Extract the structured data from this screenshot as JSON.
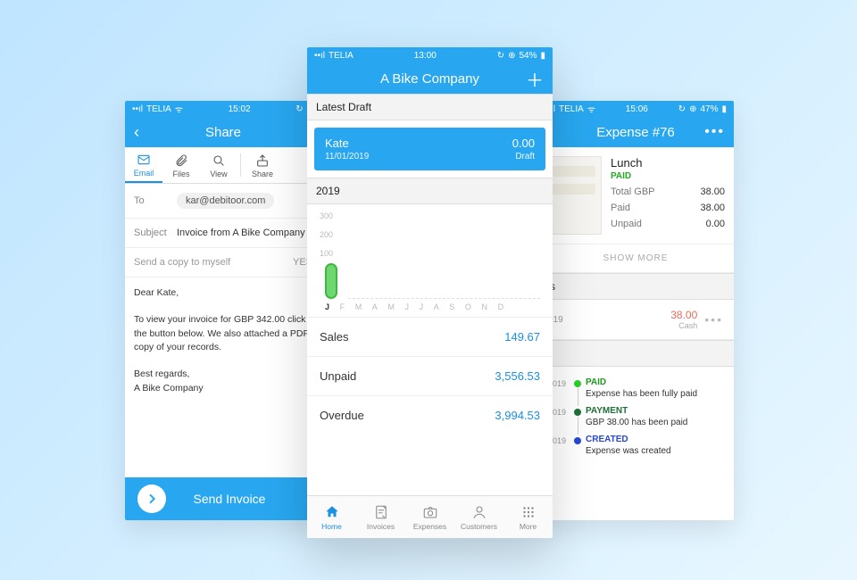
{
  "left": {
    "status": {
      "carrier": "TELIA",
      "time": "15:02"
    },
    "title": "Share",
    "tools": {
      "email": "Email",
      "files": "Files",
      "view": "View",
      "share": "Share"
    },
    "to_label": "To",
    "to_value": "kar@debitoor.com",
    "subject_label": "Subject",
    "subject_value": "Invoice from A Bike Company",
    "copy_label": "Send a copy to myself",
    "copy_value": "YES",
    "body": {
      "greeting": "Dear Kate,",
      "p1": "To view your invoice for GBP 342.00 click the button below. We also attached a PDF copy of your records.",
      "signoff1": "Best regards,",
      "signoff2": "A Bike Company"
    },
    "send_label": "Send Invoice"
  },
  "center": {
    "status": {
      "carrier": "TELIA",
      "time": "13:00",
      "battery": "54%"
    },
    "title": "A Bike Company",
    "latest_draft_header": "Latest Draft",
    "draft": {
      "name": "Kate",
      "date": "11/01/2019",
      "amount": "0.00",
      "status": "Draft"
    },
    "year": "2019",
    "y_axis": {
      "t300": "300",
      "t200": "200",
      "t100": "100"
    },
    "months": [
      "J",
      "F",
      "M",
      "A",
      "M",
      "J",
      "J",
      "A",
      "S",
      "O",
      "N",
      "D"
    ],
    "stats": {
      "sales_label": "Sales",
      "sales_value": "149.67",
      "unpaid_label": "Unpaid",
      "unpaid_value": "3,556.53",
      "overdue_label": "Overdue",
      "overdue_value": "3,994.53"
    },
    "tabs": {
      "home": "Home",
      "invoices": "Invoices",
      "expenses": "Expenses",
      "customers": "Customers",
      "more": "More"
    }
  },
  "right": {
    "status": {
      "carrier": "TELIA",
      "time": "15:06",
      "battery": "47%"
    },
    "title": "Expense #76",
    "exp": {
      "title": "Lunch",
      "paid": "PAID",
      "total_lbl": "Total GBP",
      "total_val": "38.00",
      "paid_lbl": "Paid",
      "paid_val": "38.00",
      "unpaid_lbl": "Unpaid",
      "unpaid_val": "0.00"
    },
    "showmore": "SHOW MORE",
    "payments_header": "nts",
    "pay": {
      "date": "019",
      "amount": "38.00",
      "sub": "Cash"
    },
    "history_header": "y",
    "tl": {
      "d1": "019",
      "t1a": "PAID",
      "t1b": "Expense has been fully paid",
      "d2": "019",
      "t2a": "PAYMENT",
      "t2b": "GBP 38.00 has been paid",
      "d3": "019",
      "t3a": "CREATED",
      "t3b": "Expense was created"
    }
  },
  "chart_data": {
    "type": "bar",
    "categories": [
      "J",
      "F",
      "M",
      "A",
      "M",
      "J",
      "J",
      "A",
      "S",
      "O",
      "N",
      "D"
    ],
    "values": [
      150,
      null,
      null,
      null,
      null,
      null,
      null,
      null,
      null,
      null,
      null,
      null
    ],
    "title": "2019",
    "ylabel": "",
    "ylim": [
      0,
      300
    ]
  }
}
